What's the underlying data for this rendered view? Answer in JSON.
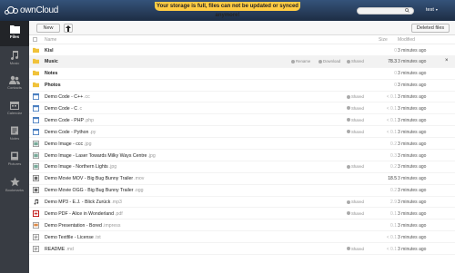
{
  "header": {
    "brand": "ownCloud",
    "notification": "Your storage is full, files can not be updated or synced anymore!",
    "user": "test",
    "user_caret": "▾"
  },
  "nav": [
    {
      "label": "Files",
      "icon": "files-icon",
      "active": true
    },
    {
      "label": "Music",
      "icon": "music-icon",
      "active": false
    },
    {
      "label": "Contacts",
      "icon": "contacts-icon",
      "active": false
    },
    {
      "label": "Calendar",
      "icon": "calendar-icon",
      "active": false
    },
    {
      "label": "Notes",
      "icon": "notes-icon",
      "active": false
    },
    {
      "label": "Pictures",
      "icon": "pictures-icon",
      "active": false
    },
    {
      "label": "Bookmarks",
      "icon": "bookmarks-icon",
      "active": false
    }
  ],
  "controls": {
    "new_label": "New",
    "upload_label": "🡅",
    "deleted_label": "Deleted files"
  },
  "table": {
    "col_name": "Name",
    "col_size": "Size",
    "col_modified": "Modified"
  },
  "actions": {
    "rename": "Rename",
    "download": "Download",
    "shared": "Shared",
    "delete": "×"
  },
  "files": [
    {
      "name": "Kisl",
      "ext": "",
      "type": "folder",
      "size": "0",
      "modified": "3 minutes ago",
      "shared": false,
      "bold": true
    },
    {
      "name": "Music",
      "ext": "",
      "type": "folder",
      "size": "78.3",
      "modified": "3 minutes ago",
      "shared": true,
      "bold": true,
      "hover": true
    },
    {
      "name": "Notes",
      "ext": "",
      "type": "folder",
      "size": "0",
      "modified": "3 minutes ago",
      "shared": false,
      "bold": true
    },
    {
      "name": "Photos",
      "ext": "",
      "type": "folder",
      "size": "0",
      "modified": "3 minutes ago",
      "shared": false,
      "bold": true
    },
    {
      "name": "Demo Code - C++",
      "ext": ".cc",
      "type": "code",
      "size": "< 0.1",
      "modified": "3 minutes ago",
      "shared": true,
      "bold": false
    },
    {
      "name": "Demo Code - C",
      "ext": ".c",
      "type": "code",
      "size": "< 0.1",
      "modified": "3 minutes ago",
      "shared": true,
      "bold": false
    },
    {
      "name": "Demo Code - PHP",
      "ext": ".php",
      "type": "code",
      "size": "< 0.1",
      "modified": "3 minutes ago",
      "shared": true,
      "bold": false
    },
    {
      "name": "Demo Code - Python",
      "ext": ".py",
      "type": "code",
      "size": "< 0.1",
      "modified": "3 minutes ago",
      "shared": true,
      "bold": false
    },
    {
      "name": "Demo Image - ccc",
      "ext": ".jpg",
      "type": "image",
      "size": "0.2",
      "modified": "3 minutes ago",
      "shared": false,
      "bold": false
    },
    {
      "name": "Demo Image - Laser Towards Milky Ways Centre",
      "ext": ".jpg",
      "type": "image",
      "size": "0.3",
      "modified": "3 minutes ago",
      "shared": false,
      "bold": false
    },
    {
      "name": "Demo Image - Northern Lights",
      "ext": ".jpg",
      "type": "image",
      "size": "0.2",
      "modified": "3 minutes ago",
      "shared": true,
      "bold": false
    },
    {
      "name": "Demo Movie MOV - Big Bug Bunny Trailer",
      "ext": ".mov",
      "type": "video",
      "size": "18.5",
      "modified": "3 minutes ago",
      "shared": false,
      "bold": false
    },
    {
      "name": "Demo Movie OGG - Big Bug Bunny Trailer",
      "ext": ".ogg",
      "type": "video",
      "size": "0.2",
      "modified": "3 minutes ago",
      "shared": false,
      "bold": false
    },
    {
      "name": "Demo MP3 - E.J. - Blick Zurück",
      "ext": ".mp3",
      "type": "audio",
      "size": "2.9",
      "modified": "3 minutes ago",
      "shared": true,
      "bold": false
    },
    {
      "name": "Demo PDF - Alice in Wonderland",
      "ext": ".pdf",
      "type": "pdf",
      "size": "0.1",
      "modified": "3 minutes ago",
      "shared": true,
      "bold": false
    },
    {
      "name": "Demo Presentation - Bored",
      "ext": ".impress",
      "type": "presentation",
      "size": "0.1",
      "modified": "3 minutes ago",
      "shared": false,
      "bold": false
    },
    {
      "name": "Demo Textfile - License",
      "ext": ".txt",
      "type": "text",
      "size": "< 0.1",
      "modified": "3 minutes ago",
      "shared": false,
      "bold": false
    },
    {
      "name": "README",
      "ext": ".md",
      "type": "text",
      "size": "< 0.1",
      "modified": "3 minutes ago",
      "shared": true,
      "bold": false
    }
  ],
  "colors": {
    "header": "#1d2d44",
    "notification": "#ffcc44",
    "nav": "#383c43",
    "folder": "#f0c23a"
  }
}
